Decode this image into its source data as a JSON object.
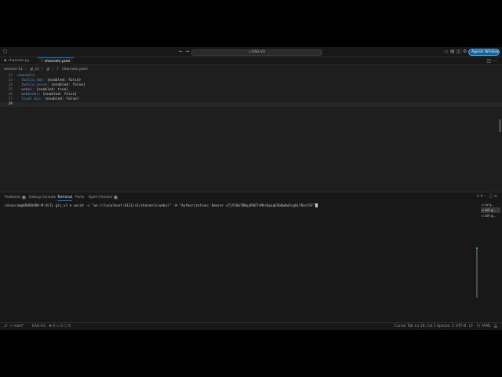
{
  "titlebar": {
    "search_text": "EAG-V3",
    "agents_button": "Agents Window"
  },
  "tabs": [
    {
      "label": "channels.py",
      "icon": "python-file-icon"
    },
    {
      "label": "channels.yaml",
      "icon": "yaml-file-icon"
    }
  ],
  "breadcrumb": [
    "session-11",
    "gl_v1",
    "gl",
    "channels.yaml"
  ],
  "editor": {
    "lines": [
      {
        "n": "22",
        "key": "channels:",
        "val": ""
      },
      {
        "n": "23",
        "key": "  twilio_sms:",
        "val": " {enabled: false}"
      },
      {
        "n": "24",
        "key": "  twilio_voice:",
        "val": " {enabled: false}"
      },
      {
        "n": "25",
        "key": "  webui:",
        "val": " {enabled: true}"
      },
      {
        "n": "26",
        "key": "  webhooks:",
        "val": " {enabled: false}"
      },
      {
        "n": "27",
        "key": "  local_mic:",
        "val": " {enabled: false}"
      },
      {
        "n": "28",
        "key": "",
        "val": ""
      }
    ]
  },
  "panel": {
    "tabs": [
      {
        "label": "Problems",
        "badge": "1"
      },
      {
        "label": "Debug Console",
        "badge": ""
      },
      {
        "label": "Terminal",
        "badge": ""
      },
      {
        "label": "Ports",
        "badge": ""
      },
      {
        "label": "Spell Checker",
        "badge": "3"
      }
    ],
    "terminal_prompt": "vikasram@GRADUARH-M-XLTL glc_v1 % ",
    "terminal_command": "wscat -c \"ws://localhost:8111/v1/channels/webui\" -H \"Authorization: Bearer xTjYC8kTBNyyPOETvMhrEpuqESb0wDw5cgULfDecCSF\"",
    "terminal_list": [
      "uv y...",
      "zsh g...",
      "zsh g..."
    ]
  },
  "statusbar": {
    "branch": "main*",
    "repo": "EAG-V3",
    "problems": "⊗ 0 ⚠ 0   ⓘ 0",
    "left_icons": "⎇",
    "cursor_pos": "Ln 28, Col 1",
    "spaces": "Spaces: 2",
    "encoding": "UTF-8",
    "eol": "LF",
    "language": "YAML",
    "extra": "Cursor Tab"
  }
}
